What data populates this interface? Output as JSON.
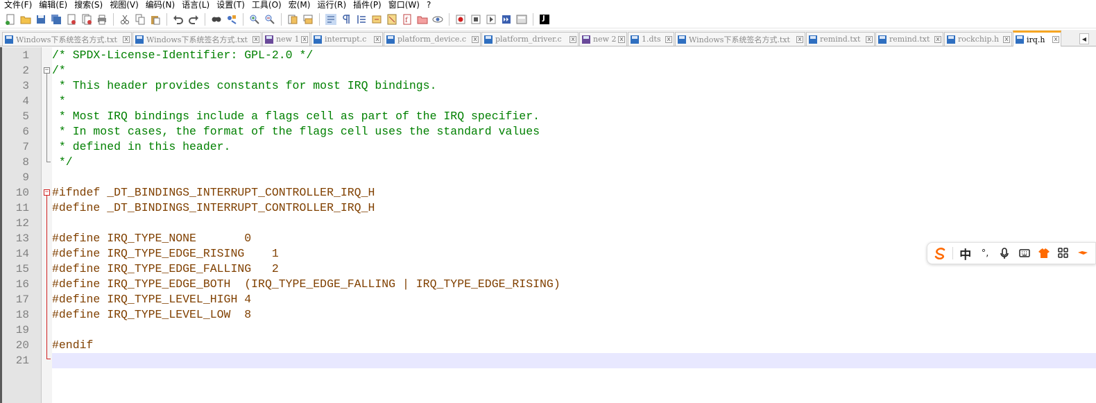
{
  "menu": [
    "文件(F)",
    "编辑(E)",
    "搜索(S)",
    "视图(V)",
    "编码(N)",
    "语言(L)",
    "设置(T)",
    "工具(O)",
    "宏(M)",
    "运行(R)",
    "插件(P)",
    "窗口(W)",
    "?"
  ],
  "toolbar": {
    "groups": [
      [
        "new-file-icon",
        "open-file-icon",
        "save-icon",
        "save-all-icon",
        "close-icon",
        "close-all-icon",
        "print-icon"
      ],
      [
        "cut-icon",
        "copy-icon",
        "paste-icon"
      ],
      [
        "undo-icon",
        "redo-icon"
      ],
      [
        "find-icon",
        "replace-icon"
      ],
      [
        "zoom-in-icon",
        "zoom-out-icon"
      ],
      [
        "sync-vertical-icon",
        "sync-horizontal-icon"
      ],
      [
        "word-wrap-icon",
        "show-all-chars-icon",
        "indent-guide-icon",
        "udl-icon",
        "doc-map-icon",
        "function-list-icon",
        "folder-workspace-icon",
        "monitoring-icon"
      ],
      [
        "record-macro-icon",
        "stop-record-icon",
        "play-macro-icon",
        "run-macro-multiple-icon",
        "save-macro-icon"
      ],
      [
        "jsx-icon"
      ]
    ],
    "jsx_label": "J"
  },
  "tabs": [
    {
      "label": "Windows下系统签名方式.txt",
      "icon": "file-saved-icon",
      "active": false
    },
    {
      "label": "Windows下系统签名方式.txt",
      "icon": "file-saved-icon",
      "active": false
    },
    {
      "label": "new 1",
      "icon": "file-unsaved-icon",
      "active": false
    },
    {
      "label": "interrupt.c",
      "icon": "file-saved-icon",
      "active": false
    },
    {
      "label": "platform_device.c",
      "icon": "file-saved-icon",
      "active": false
    },
    {
      "label": "platform_driver.c",
      "icon": "file-saved-icon",
      "active": false
    },
    {
      "label": "new 2",
      "icon": "file-unsaved-icon",
      "active": false
    },
    {
      "label": "1.dts",
      "icon": "file-saved-icon",
      "active": false
    },
    {
      "label": "Windows下系统签名方式.txt",
      "icon": "file-saved-icon",
      "active": false
    },
    {
      "label": "remind.txt",
      "icon": "file-saved-icon",
      "active": false
    },
    {
      "label": "remind.txt",
      "icon": "file-saved-icon",
      "active": false
    },
    {
      "label": "rockchip.h",
      "icon": "file-saved-icon",
      "active": false
    },
    {
      "label": "irq.h",
      "icon": "file-saved-icon",
      "active": true
    }
  ],
  "tab_close_glyph": "x",
  "tab_scroll_glyph": "◀",
  "editor": {
    "current_line": 21,
    "lines": [
      {
        "num": "1",
        "text": "/* SPDX-License-Identifier: GPL-2.0 */",
        "kind": "comment"
      },
      {
        "num": "2",
        "text": "/*",
        "kind": "comment"
      },
      {
        "num": "3",
        "text": " * This header provides constants for most IRQ bindings.",
        "kind": "comment"
      },
      {
        "num": "4",
        "text": " *",
        "kind": "comment"
      },
      {
        "num": "5",
        "text": " * Most IRQ bindings include a flags cell as part of the IRQ specifier.",
        "kind": "comment"
      },
      {
        "num": "6",
        "text": " * In most cases, the format of the flags cell uses the standard values",
        "kind": "comment"
      },
      {
        "num": "7",
        "text": " * defined in this header.",
        "kind": "comment"
      },
      {
        "num": "8",
        "text": " */",
        "kind": "comment"
      },
      {
        "num": "9",
        "text": "",
        "kind": "plain"
      },
      {
        "num": "10",
        "text": "#ifndef _DT_BINDINGS_INTERRUPT_CONTROLLER_IRQ_H",
        "kind": "preprocessor"
      },
      {
        "num": "11",
        "text": "#define _DT_BINDINGS_INTERRUPT_CONTROLLER_IRQ_H",
        "kind": "preprocessor"
      },
      {
        "num": "12",
        "text": "",
        "kind": "plain"
      },
      {
        "num": "13",
        "text": "#define IRQ_TYPE_NONE       0",
        "kind": "preprocessor"
      },
      {
        "num": "14",
        "text": "#define IRQ_TYPE_EDGE_RISING    1",
        "kind": "preprocessor"
      },
      {
        "num": "15",
        "text": "#define IRQ_TYPE_EDGE_FALLING   2",
        "kind": "preprocessor"
      },
      {
        "num": "16",
        "text": "#define IRQ_TYPE_EDGE_BOTH  (IRQ_TYPE_EDGE_FALLING | IRQ_TYPE_EDGE_RISING)",
        "kind": "preprocessor"
      },
      {
        "num": "17",
        "text": "#define IRQ_TYPE_LEVEL_HIGH 4",
        "kind": "preprocessor"
      },
      {
        "num": "18",
        "text": "#define IRQ_TYPE_LEVEL_LOW  8",
        "kind": "preprocessor"
      },
      {
        "num": "19",
        "text": "",
        "kind": "plain"
      },
      {
        "num": "20",
        "text": "#endif",
        "kind": "preprocessor"
      },
      {
        "num": "21",
        "text": "",
        "kind": "plain"
      }
    ]
  },
  "ime_toolbar": {
    "buttons": [
      {
        "name": "sogou-logo-icon",
        "label": ""
      },
      {
        "name": "chinese-mode-button",
        "label": "中"
      },
      {
        "name": "punctuation-icon",
        "label": "°,"
      },
      {
        "name": "microphone-icon",
        "label": ""
      },
      {
        "name": "keyboard-icon",
        "label": ""
      },
      {
        "name": "skin-icon",
        "label": ""
      },
      {
        "name": "toolbox-grid-icon",
        "label": ""
      },
      {
        "name": "more-icon",
        "label": ""
      }
    ]
  },
  "colors": {
    "comment": "#008000",
    "preprocessor": "#804000",
    "line_number": "#808080",
    "current_line_bg": "#e8e8ff",
    "active_tab_accent": "#f6a623",
    "fold_highlight": "#d02020",
    "sogou_orange": "#ff6a00"
  }
}
